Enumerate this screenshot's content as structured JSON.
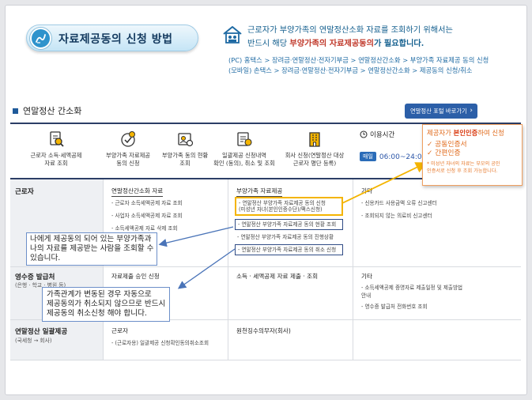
{
  "header": {
    "title": "자료제공동의 신청 방법",
    "notice_line1": "근로자가 부양가족의 연말정산소화 자료를 조회하기 위해서는",
    "notice_line2_pre": "반드시 해당 ",
    "notice_line2_em": "부양가족의 자료제공동의",
    "notice_line2_post": "가 필요합니다.",
    "path_pc": "(PC) 홈택스 > 장려금·연말정산·전자기부금 > 연말정산간소화 > 부양가족 자료제공 동의 신청",
    "path_mobile": "(모바일) 손택스 > 장려금·연말정산·전자기부금 > 연말정산간소화 > 제공동의 신청/취소"
  },
  "section": {
    "title": "연말정산 간소화",
    "portal_button": "연말정산 포털 바로가기",
    "portal_chevron": "›"
  },
  "services": [
    {
      "line1": "근로자 소득·세액공제",
      "line2": "자료 조회",
      "icon": "document-search-icon"
    },
    {
      "line1": "부양가족 자료제공",
      "line2": "동의 신청",
      "icon": "family-consent-icon"
    },
    {
      "line1": "부양가족 동의 현황",
      "line2": "조회",
      "icon": "family-status-icon"
    },
    {
      "line1": "일괄제공 신청내역",
      "line2": "확인 (동의), 취소 및 조회",
      "icon": "bulk-request-icon"
    },
    {
      "line1": "회사 신청(연말정산 대상",
      "line2": "근로자 명단 등록)",
      "icon": "company-building-icon"
    }
  ],
  "hours": {
    "label": "이용시간",
    "day_badge": "매일",
    "time": "06:00~24:00"
  },
  "table": {
    "row1": {
      "head": "근로자",
      "col1_header": "연말정산간소화 자료",
      "col1_items": [
        "- 근로자 소득세액공제 자료 조회",
        "- 사업자 소득세액공제 자료 조회",
        "- 소득세액공제 자료 삭제 조회"
      ],
      "col2_header": "부양가족 자료제공",
      "col2_gold_line1": "- 연말정산 부양가족 자료제공 동의 신청",
      "col2_gold_line2": "(미성년 자녀(본인인증수단)/팩스신청)",
      "col2_items": [
        "- 연말정산 부양가족 자료제공 동의 현황 조회",
        "- 연말정산 부양가족 자료제공 동의 진행상황",
        "- 연말정산 부양가족 자료제공 동의 취소 신청"
      ],
      "col3_header": "기타",
      "col3_items": [
        "- 신용카드 사용금액 오류 신고센터",
        "- 조회되지 않는 의료비 신고센터"
      ]
    },
    "row2": {
      "head": "영수증 발급처",
      "sub": "(은행 · 학교 · 병원 등)",
      "col1_header": "자료제출 승인 신청",
      "col2_header": "소득 · 세액공제 자료 제출 · 조회",
      "col3_header": "기타",
      "col3_items": [
        "- 소득세액공제 증명자료 제출일정 및 제출방법",
        "  안내",
        "- 영수증 발급처 전화번호 조회"
      ]
    },
    "row3": {
      "head": "연말정산 일괄제공",
      "sub": "(국세청 → 회사)",
      "col1_header": "근로자",
      "col1_items": [
        "- (근로자용) 일괄제공 신청확인동의취소조회"
      ],
      "col2_header": "원천징수의무자(회사)"
    }
  },
  "callouts": {
    "status_line1": "나에게 제공동의 되어 있는 부양가족과",
    "status_line2": "나의 자료를 제공받는 사람을 조회할 수",
    "status_line3": "있습니다.",
    "cancel_line1": "가족관계가 변동된 경우 자동으로",
    "cancel_line2": "제공동의가 취소되지 않으므로 반드시",
    "cancel_line3": "제공동의 취소신청 해야 합니다."
  },
  "cert": {
    "title_pre": "제공자가 ",
    "title_em": "본인인증",
    "title_post": "하여 신청",
    "check": "✓",
    "items": [
      "공동인증서",
      "간편인증"
    ],
    "note_line1": "* 미성년 자녀의 자료는 부모의 공인",
    "note_line2": "  인증서로 신청 후 조회 가능합니다."
  },
  "colors": {
    "accent_blue": "#2c5fa8",
    "navy": "#2c3e66",
    "gold_highlight": "#f4b400",
    "orange_text": "#e06a1b",
    "callout_border": "#6c8fc9"
  }
}
